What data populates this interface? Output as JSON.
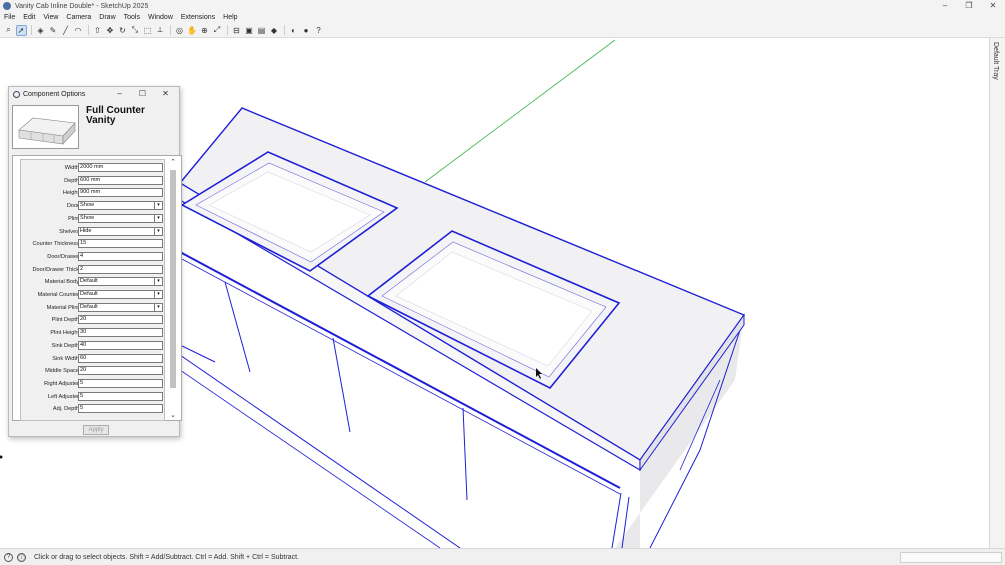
{
  "window": {
    "title": "Vanity Cab Inline Double* - SketchUp 2025",
    "controls": [
      "–",
      "❐",
      "✕"
    ]
  },
  "menu": [
    "File",
    "Edit",
    "View",
    "Camera",
    "Draw",
    "Tools",
    "Window",
    "Extensions",
    "Help"
  ],
  "toolbar": {
    "icons": [
      "search-icon",
      "select-arrow-icon",
      "eraser-icon",
      "paint-icon",
      "line-icon",
      "arc-icon",
      "push-pull-icon",
      "move-icon",
      "rotate-icon",
      "scale-icon",
      "offset-icon",
      "tape-icon",
      "orbit-icon",
      "pan-icon",
      "zoom-icon",
      "zoom-extents-icon",
      "section-icon",
      "component-icon",
      "group-icon",
      "tag-icon",
      "style-icon",
      "shadow-icon",
      "help-icon"
    ],
    "glyphs": [
      "⌕",
      "➚",
      "◈",
      "✎",
      "╱",
      "◠",
      "⇧",
      "✥",
      "↻",
      "⤡",
      "⬚",
      "⟂",
      "◎",
      "✋",
      "⊕",
      "⤢",
      "⊟",
      "▣",
      "▤",
      "◆",
      "◐",
      "●",
      "?"
    ]
  },
  "tray": {
    "label": "Default Tray"
  },
  "status": {
    "text": "Click or drag to select objects. Shift = Add/Subtract. Ctrl = Add. Shift + Ctrl = Subtract.",
    "icon1": "?",
    "icon2": "ⓘ"
  },
  "dialog": {
    "title": "Component Options",
    "controls": [
      "–",
      "☐",
      "✕"
    ],
    "component_name": "Full Counter Vanity",
    "apply_label": "Apply",
    "scroll_up": "⌃",
    "scroll_down": "⌄",
    "params": [
      {
        "label": "Width",
        "value": "2000 mm",
        "type": "text"
      },
      {
        "label": "Depth",
        "value": "600 mm",
        "type": "text"
      },
      {
        "label": "Height",
        "value": "900 mm",
        "type": "text"
      },
      {
        "label": "Door",
        "value": "Show",
        "type": "select"
      },
      {
        "label": "Plint",
        "value": "Show",
        "type": "select"
      },
      {
        "label": "Shelves",
        "value": "Hide",
        "type": "select"
      },
      {
        "label": "Counter Thickness",
        "value": "15",
        "type": "text"
      },
      {
        "label": "Door/Drawer",
        "value": "4",
        "type": "text"
      },
      {
        "label": "Door/Drawer Thick",
        "value": "2",
        "type": "text"
      },
      {
        "label": "Material Body",
        "value": "Default",
        "type": "select"
      },
      {
        "label": "Material Counter",
        "value": "Default",
        "type": "select"
      },
      {
        "label": "Material Plint",
        "value": "Default",
        "type": "select"
      },
      {
        "label": "Plint Depth",
        "value": "20",
        "type": "text"
      },
      {
        "label": "Plint Height",
        "value": "30",
        "type": "text"
      },
      {
        "label": "Sink Depth",
        "value": "40",
        "type": "text"
      },
      {
        "label": "Sink Width",
        "value": "60",
        "type": "text"
      },
      {
        "label": "Middle Space",
        "value": "20",
        "type": "text"
      },
      {
        "label": "Right Adjuster",
        "value": "5",
        "type": "text"
      },
      {
        "label": "Left Adjuster",
        "value": "5",
        "type": "text"
      },
      {
        "label": "Adj. Depth",
        "value": "5",
        "type": "text"
      }
    ]
  },
  "colors": {
    "selection_edge": "#1f1fd6",
    "axis_green": "#3cb34a",
    "axis_red": "#c23a3a",
    "face_light": "#f1f1f3"
  }
}
